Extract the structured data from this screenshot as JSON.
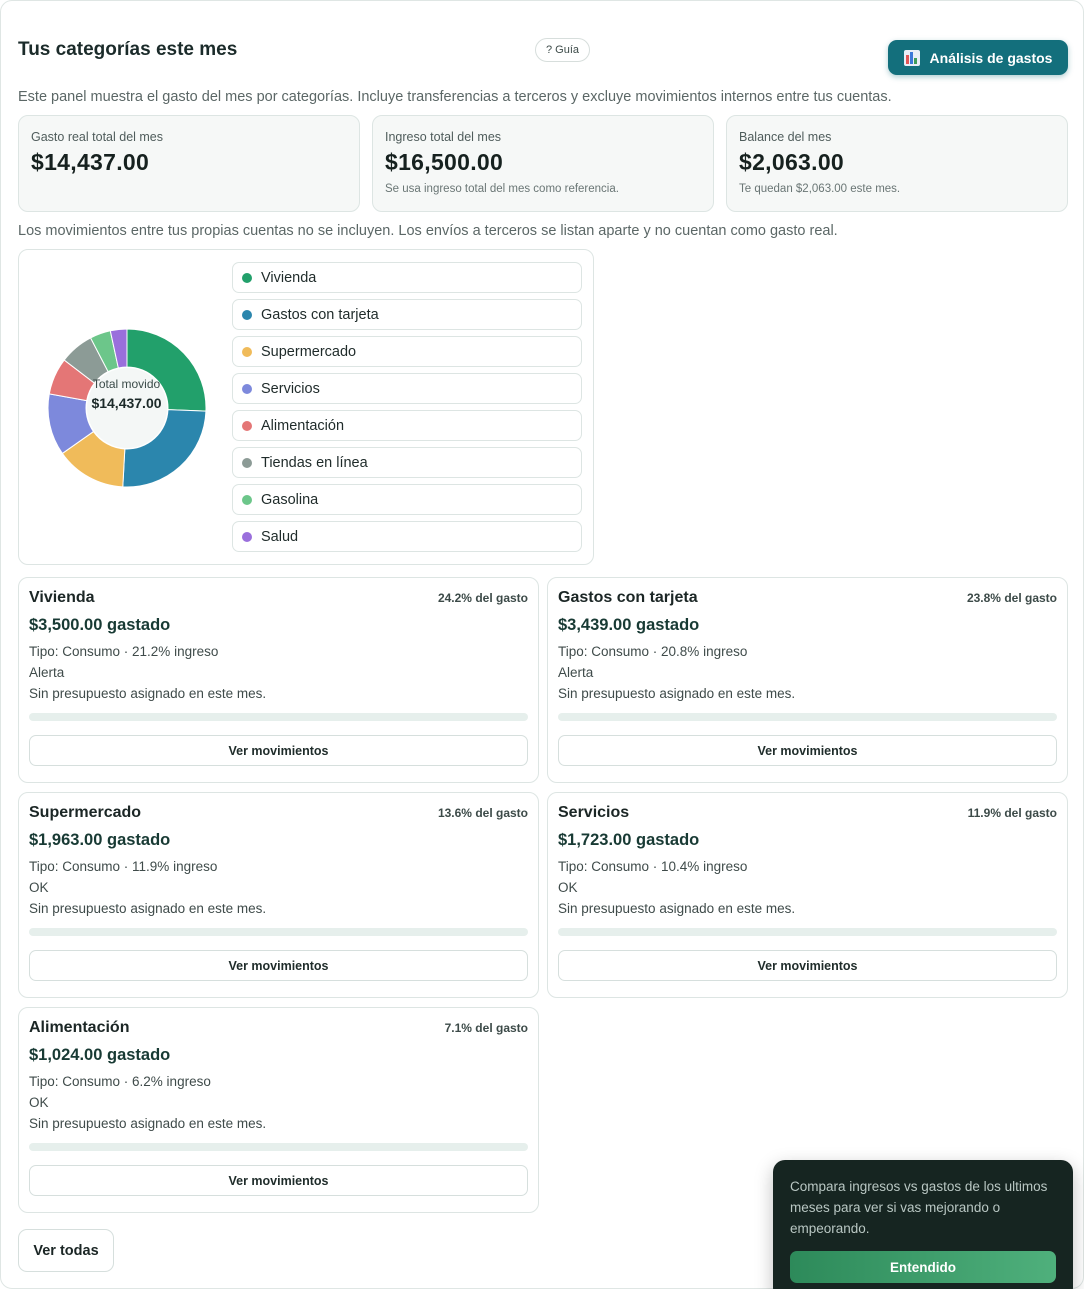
{
  "header": {
    "title": "Tus categorías este mes",
    "guide_label": "? Guía",
    "analysis_button_label": "Análisis de gastos",
    "description": "Este panel muestra el gasto del mes por categorías. Incluye transferencias a terceros y excluye movimientos internos entre tus cuentas."
  },
  "summary": {
    "spent": {
      "label": "Gasto real total del mes",
      "value": "$14,437.00",
      "note": ""
    },
    "income": {
      "label": "Ingreso total del mes",
      "value": "$16,500.00",
      "note": "Se usa ingreso total del mes como referencia."
    },
    "balance": {
      "label": "Balance del mes",
      "value": "$2,063.00",
      "note": "Te quedan $2,063.00 este mes."
    }
  },
  "note": "Los movimientos entre tus propias cuentas no se incluyen. Los envíos a terceros se listan aparte y no cuentan como gasto real.",
  "chart": {
    "center_label": "Total movido",
    "center_value": "$14,437.00"
  },
  "chart_data": {
    "type": "pie",
    "categories": [
      "Vivienda",
      "Gastos con tarjeta",
      "Supermercado",
      "Servicios",
      "Alimentación",
      "Tiendas en línea",
      "Gasolina",
      "Salud"
    ],
    "values": [
      24.2,
      23.8,
      13.6,
      11.9,
      7.1,
      6.6,
      4.0,
      3.2
    ],
    "colors": [
      "#22a06b",
      "#2b86ad",
      "#f0bb5a",
      "#7d89dc",
      "#e47676",
      "#8c9b96",
      "#6cc68a",
      "#9a6fdc"
    ]
  },
  "legend": [
    {
      "label": "Vivienda",
      "color": "#22a06b"
    },
    {
      "label": "Gastos con tarjeta",
      "color": "#2b86ad"
    },
    {
      "label": "Supermercado",
      "color": "#f0bb5a"
    },
    {
      "label": "Servicios",
      "color": "#7d89dc"
    },
    {
      "label": "Alimentación",
      "color": "#e47676"
    },
    {
      "label": "Tiendas en línea",
      "color": "#8c9b96"
    },
    {
      "label": "Gasolina",
      "color": "#6cc68a"
    },
    {
      "label": "Salud",
      "color": "#9a6fdc"
    }
  ],
  "categories": [
    {
      "name": "Vivienda",
      "pct": "24.2% del gasto",
      "amount": "$3,500.00 gastado",
      "type": "Tipo: Consumo · 21.2% ingreso",
      "status": "Alerta",
      "budget": "Sin presupuesto asignado en este mes.",
      "button": "Ver movimientos"
    },
    {
      "name": "Gastos con tarjeta",
      "pct": "23.8% del gasto",
      "amount": "$3,439.00 gastado",
      "type": "Tipo: Consumo · 20.8% ingreso",
      "status": "Alerta",
      "budget": "Sin presupuesto asignado en este mes.",
      "button": "Ver movimientos"
    },
    {
      "name": "Supermercado",
      "pct": "13.6% del gasto",
      "amount": "$1,963.00 gastado",
      "type": "Tipo: Consumo · 11.9% ingreso",
      "status": "OK",
      "budget": "Sin presupuesto asignado en este mes.",
      "button": "Ver movimientos"
    },
    {
      "name": "Servicios",
      "pct": "11.9% del gasto",
      "amount": "$1,723.00 gastado",
      "type": "Tipo: Consumo · 10.4% ingreso",
      "status": "OK",
      "budget": "Sin presupuesto asignado en este mes.",
      "button": "Ver movimientos"
    },
    {
      "name": "Alimentación",
      "pct": "7.1% del gasto",
      "amount": "$1,024.00 gastado",
      "type": "Tipo: Consumo · 6.2% ingreso",
      "status": "OK",
      "budget": "Sin presupuesto asignado en este mes.",
      "button": "Ver movimientos"
    }
  ],
  "view_all_label": "Ver todas",
  "toast": {
    "text": "Compara ingresos vs gastos de los ultimos meses para ver si vas mejorando o empeorando.",
    "button": "Entendido"
  },
  "icons": {
    "analysis": "bar-chart-icon"
  }
}
